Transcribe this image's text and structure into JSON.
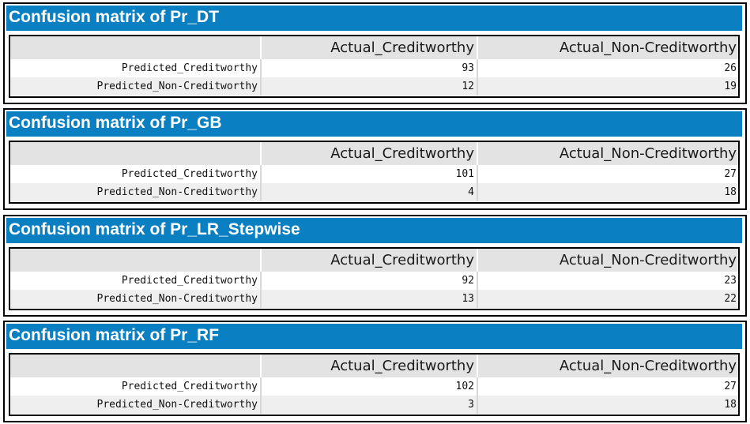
{
  "colors": {
    "title_bar": "#0a7fc2",
    "title_text": "#ffffff",
    "header_row": "#e3e3e3",
    "alt_row": "#efefef",
    "border": "#000000"
  },
  "panels": [
    {
      "title": "Confusion matrix of Pr_DT",
      "columns": [
        "",
        "Actual_Creditworthy",
        "Actual_Non-Creditworthy"
      ],
      "rows": [
        {
          "label": "Predicted_Creditworthy",
          "values": [
            "93",
            "26"
          ]
        },
        {
          "label": "Predicted_Non-Creditworthy",
          "values": [
            "12",
            "19"
          ]
        }
      ]
    },
    {
      "title": "Confusion matrix of Pr_GB",
      "columns": [
        "",
        "Actual_Creditworthy",
        "Actual_Non-Creditworthy"
      ],
      "rows": [
        {
          "label": "Predicted_Creditworthy",
          "values": [
            "101",
            "27"
          ]
        },
        {
          "label": "Predicted_Non-Creditworthy",
          "values": [
            "4",
            "18"
          ]
        }
      ]
    },
    {
      "title": "Confusion matrix of Pr_LR_Stepwise",
      "columns": [
        "",
        "Actual_Creditworthy",
        "Actual_Non-Creditworthy"
      ],
      "rows": [
        {
          "label": "Predicted_Creditworthy",
          "values": [
            "92",
            "23"
          ]
        },
        {
          "label": "Predicted_Non-Creditworthy",
          "values": [
            "13",
            "22"
          ]
        }
      ]
    },
    {
      "title": "Confusion matrix of Pr_RF",
      "columns": [
        "",
        "Actual_Creditworthy",
        "Actual_Non-Creditworthy"
      ],
      "rows": [
        {
          "label": "Predicted_Creditworthy",
          "values": [
            "102",
            "27"
          ]
        },
        {
          "label": "Predicted_Non-Creditworthy",
          "values": [
            "3",
            "18"
          ]
        }
      ]
    }
  ]
}
